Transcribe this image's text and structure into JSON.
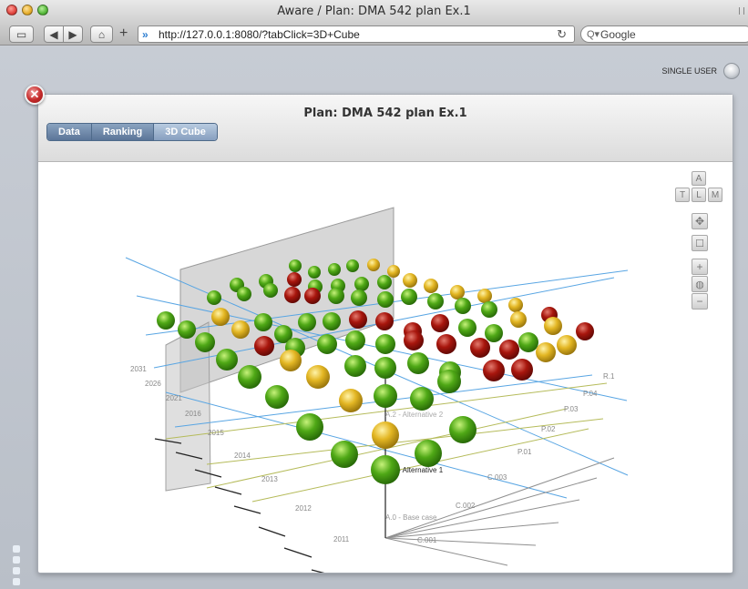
{
  "browser": {
    "window_title": "Aware / Plan: DMA 542 plan Ex.1",
    "url": "http://127.0.0.1:8080/?tabClick=3D+Cube",
    "search_placeholder": "Google"
  },
  "app": {
    "single_user_label": "SINGLE USER",
    "plan_title": "Plan: DMA 542 plan Ex.1",
    "tabs": [
      {
        "label": "Data",
        "active": false
      },
      {
        "label": "Ranking",
        "active": false
      },
      {
        "label": "3D Cube",
        "active": true
      }
    ],
    "view_controls": [
      "A",
      "T",
      "L",
      "M"
    ]
  },
  "cube": {
    "year_labels": [
      "2031",
      "2026",
      "2021",
      "2016",
      "2015",
      "2014",
      "2013",
      "2012",
      "2011"
    ],
    "criteria_labels": [
      "C.001",
      "C.002",
      "C.003",
      "P.01",
      "P.02",
      "P.03",
      "P.04",
      "R.1"
    ],
    "alternative_labels": [
      "A.0 - Base case",
      "A.1 - Alternative 1",
      "A.2 - Alternative 2"
    ],
    "colors": {
      "green": "#3f9c0d",
      "yellow": "#e0b21c",
      "red": "#a8160d"
    }
  }
}
